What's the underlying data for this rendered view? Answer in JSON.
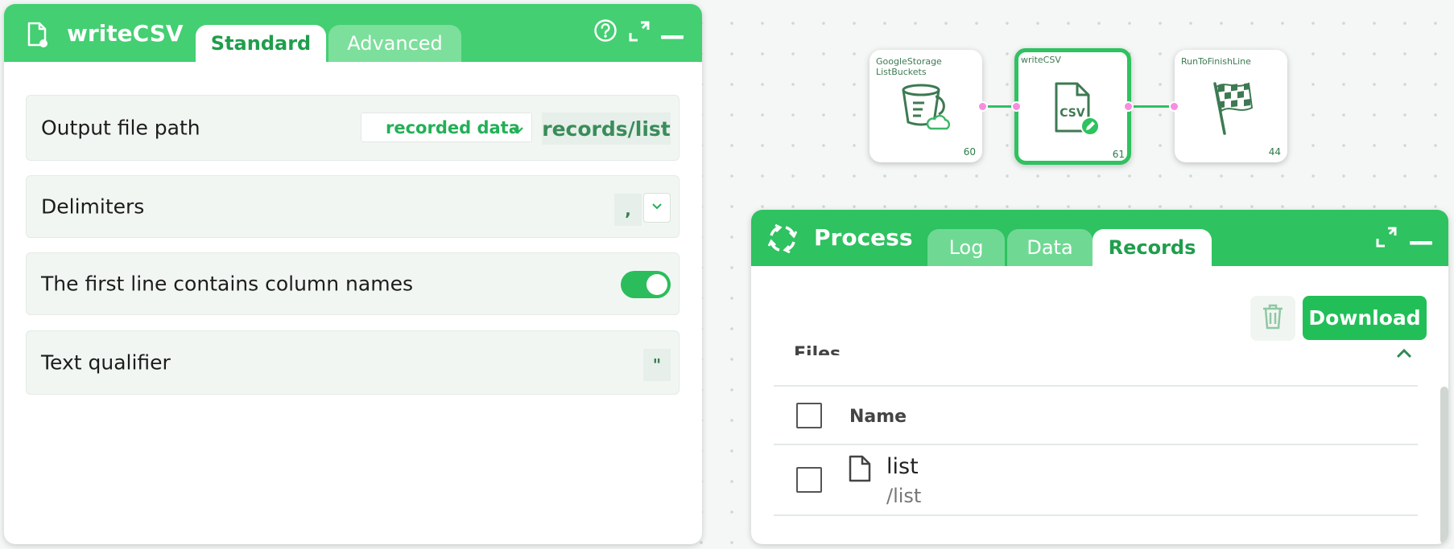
{
  "config_panel": {
    "title": "writeCSV",
    "tabs": [
      {
        "label": "Standard",
        "active": true
      },
      {
        "label": "Advanced",
        "active": false
      }
    ],
    "rows": {
      "output": {
        "label": "Output file path",
        "source": "recorded data",
        "path": "records/list"
      },
      "delimiters": {
        "label": "Delimiters",
        "value": ","
      },
      "header": {
        "label": "The first line contains column names",
        "enabled": true
      },
      "qualifier": {
        "label": "Text qualifier",
        "value": "\""
      }
    }
  },
  "nodes": [
    {
      "title": "GoogleStorage ListBuckets",
      "number": "60",
      "icon": "bucket-cloud-icon"
    },
    {
      "title": "writeCSV",
      "number": "61",
      "icon": "csv-file-icon",
      "selected": true
    },
    {
      "title": "RunToFinishLine",
      "number": "44",
      "icon": "checkered-flag-icon"
    }
  ],
  "process_panel": {
    "title": "Process",
    "tabs": [
      {
        "label": "Log",
        "active": false
      },
      {
        "label": "Data",
        "active": false
      },
      {
        "label": "Records",
        "active": true
      }
    ],
    "download_label": "Download",
    "section_title": "Files",
    "column_name": "Name",
    "files": [
      {
        "name": "list",
        "path": "/list"
      }
    ]
  },
  "colors": {
    "header_green": "#44cf72",
    "accent_green": "#2ec260",
    "port_pink": "#f68de0"
  }
}
